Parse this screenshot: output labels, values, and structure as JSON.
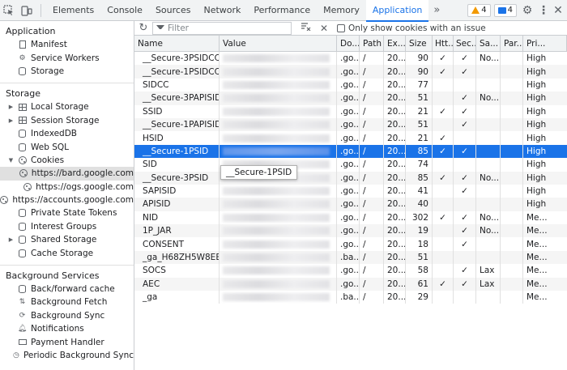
{
  "topbar": {
    "tabs": [
      {
        "label": "Elements"
      },
      {
        "label": "Console"
      },
      {
        "label": "Sources"
      },
      {
        "label": "Network"
      },
      {
        "label": "Performance"
      },
      {
        "label": "Memory"
      },
      {
        "label": "Application"
      }
    ],
    "active_tab": "Application",
    "more_label": "»",
    "warnings_count": "4",
    "messages_count": "4"
  },
  "sidebar": {
    "application": {
      "title": "Application",
      "items": [
        {
          "label": "Manifest",
          "icon": "file-icon"
        },
        {
          "label": "Service Workers",
          "icon": "gear-icon"
        },
        {
          "label": "Storage",
          "icon": "database-icon"
        }
      ]
    },
    "storage": {
      "title": "Storage",
      "items": [
        {
          "label": "Local Storage",
          "icon": "grid-icon",
          "expandable": true
        },
        {
          "label": "Session Storage",
          "icon": "grid-icon",
          "expandable": true
        },
        {
          "label": "IndexedDB",
          "icon": "database-icon"
        },
        {
          "label": "Web SQL",
          "icon": "database-icon"
        },
        {
          "label": "Cookies",
          "icon": "cookie-icon",
          "expanded": true
        },
        {
          "label": "https://bard.google.com",
          "icon": "cookie-icon",
          "child": true,
          "selected": true
        },
        {
          "label": "https://ogs.google.com",
          "icon": "cookie-icon",
          "child": true
        },
        {
          "label": "https://accounts.google.com",
          "icon": "cookie-icon",
          "child": true
        },
        {
          "label": "Private State Tokens",
          "icon": "database-icon"
        },
        {
          "label": "Interest Groups",
          "icon": "database-icon"
        },
        {
          "label": "Shared Storage",
          "icon": "database-icon",
          "expandable": true
        },
        {
          "label": "Cache Storage",
          "icon": "database-icon"
        }
      ]
    },
    "background": {
      "title": "Background Services",
      "items": [
        {
          "label": "Back/forward cache",
          "icon": "database-icon"
        },
        {
          "label": "Background Fetch",
          "icon": "sync-icon"
        },
        {
          "label": "Background Sync",
          "icon": "sync-icon"
        },
        {
          "label": "Notifications",
          "icon": "bell-icon"
        },
        {
          "label": "Payment Handler",
          "icon": "card-icon"
        },
        {
          "label": "Periodic Background Sync",
          "icon": "clock-icon"
        }
      ]
    }
  },
  "toolbar": {
    "filter_placeholder": "Filter",
    "only_issues_label": "Only show cookies with an issue"
  },
  "table": {
    "headers": [
      "Name",
      "Value",
      "Do...",
      "Path",
      "Ex...",
      "Size",
      "Htt...",
      "Sec...",
      "Sa...",
      "Par...",
      "Pri..."
    ],
    "rows": [
      {
        "name": "__Secure-3PSIDCC",
        "domain": ".go...",
        "path": "/",
        "expires": "20...",
        "size": "90",
        "http": "✓",
        "secure": "✓",
        "same": "No...",
        "prio": "High"
      },
      {
        "name": "__Secure-1PSIDCC",
        "domain": ".go...",
        "path": "/",
        "expires": "20...",
        "size": "90",
        "http": "✓",
        "secure": "✓",
        "same": "",
        "prio": "High"
      },
      {
        "name": "SIDCC",
        "domain": ".go...",
        "path": "/",
        "expires": "20...",
        "size": "77",
        "http": "",
        "secure": "",
        "same": "",
        "prio": "High"
      },
      {
        "name": "__Secure-3PAPISID",
        "domain": ".go...",
        "path": "/",
        "expires": "20...",
        "size": "51",
        "http": "",
        "secure": "✓",
        "same": "No...",
        "prio": "High"
      },
      {
        "name": "SSID",
        "domain": ".go...",
        "path": "/",
        "expires": "20...",
        "size": "21",
        "http": "✓",
        "secure": "✓",
        "same": "",
        "prio": "High"
      },
      {
        "name": "__Secure-1PAPISID",
        "domain": ".go...",
        "path": "/",
        "expires": "20...",
        "size": "51",
        "http": "",
        "secure": "✓",
        "same": "",
        "prio": "High"
      },
      {
        "name": "HSID",
        "domain": ".go...",
        "path": "/",
        "expires": "20...",
        "size": "21",
        "http": "✓",
        "secure": "",
        "same": "",
        "prio": "High"
      },
      {
        "name": "__Secure-1PSID",
        "domain": ".go...",
        "path": "/",
        "expires": "20...",
        "size": "85",
        "http": "✓",
        "secure": "✓",
        "same": "",
        "prio": "High",
        "selected": true
      },
      {
        "name": "SID",
        "domain": ".go...",
        "path": "/",
        "expires": "20...",
        "size": "74",
        "http": "",
        "secure": "",
        "same": "",
        "prio": "High"
      },
      {
        "name": "__Secure-3PSID",
        "domain": ".go...",
        "path": "/",
        "expires": "20...",
        "size": "85",
        "http": "✓",
        "secure": "✓",
        "same": "No...",
        "prio": "High"
      },
      {
        "name": "SAPISID",
        "domain": ".go...",
        "path": "/",
        "expires": "20...",
        "size": "41",
        "http": "",
        "secure": "✓",
        "same": "",
        "prio": "High"
      },
      {
        "name": "APISID",
        "domain": ".go...",
        "path": "/",
        "expires": "20...",
        "size": "40",
        "http": "",
        "secure": "",
        "same": "",
        "prio": "High"
      },
      {
        "name": "NID",
        "domain": ".go...",
        "path": "/",
        "expires": "20...",
        "size": "302",
        "http": "✓",
        "secure": "✓",
        "same": "No...",
        "prio": "Me..."
      },
      {
        "name": "1P_JAR",
        "domain": ".go...",
        "path": "/",
        "expires": "20...",
        "size": "19",
        "http": "",
        "secure": "✓",
        "same": "No...",
        "prio": "Me..."
      },
      {
        "name": "CONSENT",
        "domain": ".go...",
        "path": "/",
        "expires": "20...",
        "size": "18",
        "http": "",
        "secure": "✓",
        "same": "",
        "prio": "Me..."
      },
      {
        "name": "_ga_H68ZH5W8EE",
        "domain": ".ba...",
        "path": "/",
        "expires": "20...",
        "size": "51",
        "http": "",
        "secure": "",
        "same": "",
        "prio": "Me..."
      },
      {
        "name": "SOCS",
        "domain": ".go...",
        "path": "/",
        "expires": "20...",
        "size": "58",
        "http": "",
        "secure": "✓",
        "same": "Lax",
        "prio": "Me..."
      },
      {
        "name": "AEC",
        "domain": ".go...",
        "path": "/",
        "expires": "20...",
        "size": "61",
        "http": "✓",
        "secure": "✓",
        "same": "Lax",
        "prio": "Me..."
      },
      {
        "name": "_ga",
        "domain": ".ba...",
        "path": "/",
        "expires": "20...",
        "size": "29",
        "http": "",
        "secure": "",
        "same": "",
        "prio": "Me..."
      }
    ]
  },
  "tooltip": {
    "text": "__Secure-1PSID"
  }
}
